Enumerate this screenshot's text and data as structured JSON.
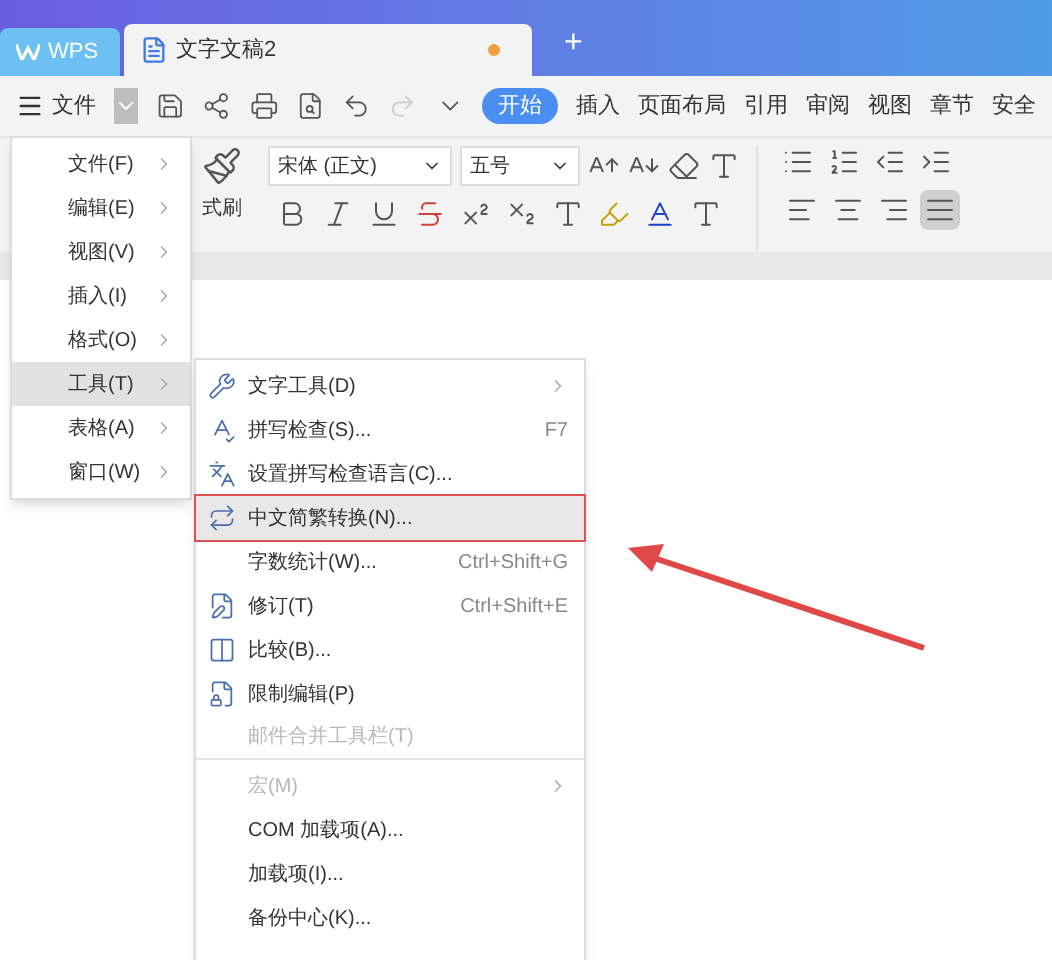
{
  "window": {
    "app_tab": "WPS",
    "doc_tab": "文字文稿2",
    "doc_unsaved": true,
    "new_tab": "+"
  },
  "toolbar": {
    "file_menu": "文件",
    "tabs": [
      {
        "label": "开始",
        "selected": true
      },
      {
        "label": "插入",
        "selected": false
      },
      {
        "label": "页面布局",
        "selected": false
      },
      {
        "label": "引用",
        "selected": false
      },
      {
        "label": "审阅",
        "selected": false
      },
      {
        "label": "视图",
        "selected": false
      },
      {
        "label": "章节",
        "selected": false
      },
      {
        "label": "安全",
        "selected": false
      }
    ]
  },
  "ribbon": {
    "format_painter": "式刷",
    "font": "宋体 (正文)",
    "size": "五号",
    "align_buttons": [
      {
        "selected": false
      },
      {
        "selected": false
      },
      {
        "selected": false
      },
      {
        "selected": true
      }
    ]
  },
  "main_menu": [
    {
      "label": "文件(F)",
      "selected": false
    },
    {
      "label": "编辑(E)",
      "selected": false
    },
    {
      "label": "视图(V)",
      "selected": false
    },
    {
      "label": "插入(I)",
      "selected": false
    },
    {
      "label": "格式(O)",
      "selected": false
    },
    {
      "label": "工具(T)",
      "selected": true
    },
    {
      "label": "表格(A)",
      "selected": false
    },
    {
      "label": "窗口(W)",
      "selected": false
    }
  ],
  "tools_menu": [
    {
      "label": "文字工具(D)",
      "submenu": true,
      "disabled": false,
      "highlighted": false
    },
    {
      "label": "拼写检查(S)...",
      "shortcut": "F7",
      "submenu": false,
      "disabled": false,
      "highlighted": false
    },
    {
      "label": "设置拼写检查语言(C)...",
      "submenu": false,
      "disabled": false,
      "highlighted": false
    },
    {
      "label": "中文简繁转换(N)...",
      "submenu": false,
      "disabled": false,
      "highlighted": true
    },
    {
      "label": "字数统计(W)...",
      "shortcut": "Ctrl+Shift+G",
      "submenu": false,
      "disabled": false,
      "highlighted": false
    },
    {
      "label": "修订(T)",
      "shortcut": "Ctrl+Shift+E",
      "submenu": false,
      "disabled": false,
      "highlighted": false
    },
    {
      "label": "比较(B)...",
      "submenu": false,
      "disabled": false,
      "highlighted": false
    },
    {
      "label": "限制编辑(P)",
      "submenu": false,
      "disabled": false,
      "highlighted": false
    },
    {
      "label": "邮件合并工具栏(T)",
      "submenu": false,
      "disabled": true,
      "highlighted": false,
      "divider_after": true
    },
    {
      "label": "宏(M)",
      "submenu": true,
      "disabled": true,
      "highlighted": false
    },
    {
      "label": "COM 加载项(A)...",
      "submenu": false,
      "disabled": false,
      "highlighted": false
    },
    {
      "label": "加载项(I)...",
      "submenu": false,
      "disabled": false,
      "highlighted": false
    },
    {
      "label": "备份中心(K)...",
      "submenu": false,
      "disabled": false,
      "highlighted": false
    }
  ]
}
